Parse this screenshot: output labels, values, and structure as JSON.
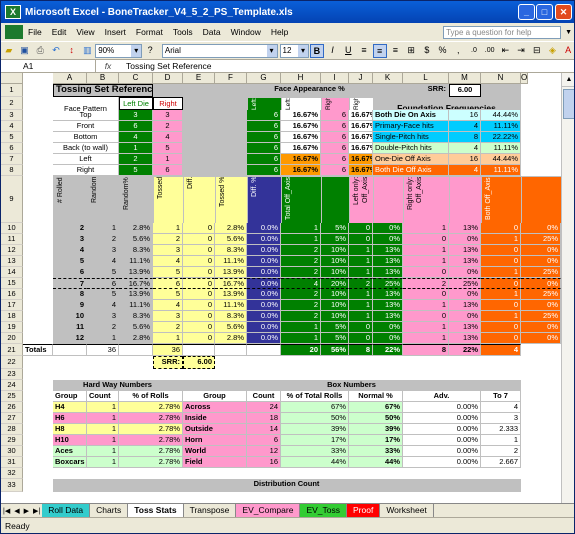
{
  "window": {
    "title": "Microsoft Excel - BoneTracker_V4_5_2_PS_Template.xls"
  },
  "menu": [
    "File",
    "Edit",
    "View",
    "Insert",
    "Format",
    "Tools",
    "Data",
    "Window",
    "Help"
  ],
  "help_placeholder": "Type a question for help",
  "toolbar": {
    "zoom": "90%",
    "font": "Arial",
    "size": "12"
  },
  "formula": {
    "cell": "A1",
    "fx": "fx",
    "content": "Tossing Set Reference"
  },
  "columns": [
    "A",
    "B",
    "C",
    "D",
    "E",
    "F",
    "G",
    "H",
    "I",
    "J",
    "K",
    "L",
    "M",
    "N",
    "O"
  ],
  "rows": [
    "1",
    "2",
    "3",
    "4",
    "5",
    "6",
    "7",
    "8",
    "9",
    "10",
    "11",
    "12",
    "13",
    "14",
    "15",
    "16",
    "17",
    "18",
    "19",
    "20",
    "21",
    "22",
    "23",
    "24",
    "25",
    "26",
    "27",
    "28",
    "29",
    "30",
    "31",
    "32",
    "33"
  ],
  "top": {
    "title": "Tossing Set Reference",
    "face_pattern": "Face Pattern",
    "left_die": "Left Die",
    "right_die": "Right Die",
    "face_appearance": "Face Appearance %",
    "srr_label": "SRR:",
    "srr_value": "6.00",
    "foundation": "Foundation Frequencies",
    "left_count": "Left: Count",
    "left_pct": "Left: %",
    "right_count": "Right: Count",
    "right_pct": "Right: %"
  },
  "faces": [
    {
      "name": "Top",
      "l": "3",
      "r": "3",
      "lc": "6",
      "lp": "16.67%",
      "rc": "6",
      "rp": "16.67%",
      "f": "Both Die On Axis",
      "fn": "16",
      "fp": "44.44%"
    },
    {
      "name": "Front",
      "l": "6",
      "r": "2",
      "lc": "6",
      "lp": "16.67%",
      "rc": "6",
      "rp": "16.67%",
      "f": "Primary-Face hits",
      "fn": "4",
      "fp": "11.11%"
    },
    {
      "name": "Bottom",
      "l": "4",
      "r": "4",
      "lc": "6",
      "lp": "16.67%",
      "rc": "6",
      "rp": "16.67%",
      "f": "Single-Pitch hits",
      "fn": "8",
      "fp": "22.22%"
    },
    {
      "name": "Back (to wall)",
      "l": "1",
      "r": "5",
      "lc": "6",
      "lp": "16.67%",
      "rc": "6",
      "rp": "16.67%",
      "f": "Double-Pitch hits",
      "fn": "4",
      "fp": "11.11%"
    },
    {
      "name": "Left",
      "l": "2",
      "r": "1",
      "lc": "6",
      "lp": "16.67%",
      "rc": "6",
      "rp": "16.67%",
      "f": "One-Die Off Axis",
      "fn": "16",
      "fp": "44.44%"
    },
    {
      "name": "Right",
      "l": "5",
      "r": "6",
      "lc": "6",
      "lp": "16.67%",
      "rc": "6",
      "rp": "16.67%",
      "f": "Both Die Off Axis",
      "fn": "4",
      "fp": "11.11%"
    }
  ],
  "hdr9": [
    "# Rolled",
    "Random",
    "Random%",
    "Tossed",
    "Diff.",
    "Tossed %",
    "Diff. %",
    "Total Off_Axis",
    "",
    "Left only: Off_Axis",
    "",
    "Right only: Off_Axis",
    "",
    "Both Off_Axis",
    ""
  ],
  "rolls": [
    [
      "2",
      "1",
      "2.8%",
      "1",
      "0",
      "2.8%",
      "0.0%",
      "1",
      "5%",
      "0",
      "0%",
      "1",
      "13%",
      "0",
      "0%"
    ],
    [
      "3",
      "2",
      "5.6%",
      "2",
      "0",
      "5.6%",
      "0.0%",
      "1",
      "5%",
      "0",
      "0%",
      "0",
      "0%",
      "1",
      "25%"
    ],
    [
      "4",
      "3",
      "8.3%",
      "3",
      "0",
      "8.3%",
      "0.0%",
      "2",
      "10%",
      "1",
      "13%",
      "1",
      "13%",
      "0",
      "0%"
    ],
    [
      "5",
      "4",
      "11.1%",
      "4",
      "0",
      "11.1%",
      "0.0%",
      "2",
      "10%",
      "1",
      "13%",
      "1",
      "13%",
      "0",
      "0%"
    ],
    [
      "6",
      "5",
      "13.9%",
      "5",
      "0",
      "13.9%",
      "0.0%",
      "2",
      "10%",
      "1",
      "13%",
      "0",
      "0%",
      "1",
      "25%"
    ],
    [
      "7",
      "6",
      "16.7%",
      "6",
      "0",
      "16.7%",
      "0.0%",
      "4",
      "20%",
      "2",
      "25%",
      "2",
      "25%",
      "0",
      "0%"
    ],
    [
      "8",
      "5",
      "13.9%",
      "5",
      "0",
      "13.9%",
      "0.0%",
      "2",
      "10%",
      "1",
      "13%",
      "0",
      "0%",
      "1",
      "25%"
    ],
    [
      "9",
      "4",
      "11.1%",
      "4",
      "0",
      "11.1%",
      "0.0%",
      "2",
      "10%",
      "1",
      "13%",
      "1",
      "13%",
      "0",
      "0%"
    ],
    [
      "10",
      "3",
      "8.3%",
      "3",
      "0",
      "8.3%",
      "0.0%",
      "2",
      "10%",
      "1",
      "13%",
      "0",
      "0%",
      "1",
      "25%"
    ],
    [
      "11",
      "2",
      "5.6%",
      "2",
      "0",
      "5.6%",
      "0.0%",
      "1",
      "5%",
      "0",
      "0%",
      "1",
      "13%",
      "0",
      "0%"
    ],
    [
      "12",
      "1",
      "2.8%",
      "1",
      "0",
      "2.8%",
      "0.0%",
      "1",
      "5%",
      "0",
      "0%",
      "1",
      "13%",
      "0",
      "0%"
    ]
  ],
  "totals": {
    "label": "Totals",
    "random": "36",
    "tossed": "36",
    "t1": "20",
    "t2": "56%",
    "l1": "8",
    "l2": "22%",
    "r1": "8",
    "r2": "22%",
    "b1": "4",
    "b2": "11%"
  },
  "srr2": {
    "label": "SRR:",
    "value": "6.00"
  },
  "hardway": {
    "title": "Hard Way Numbers",
    "h": [
      "Group",
      "Count",
      "% of Rolls"
    ],
    "rows": [
      [
        "H4",
        "1",
        "2.78%"
      ],
      [
        "H6",
        "1",
        "2.78%"
      ],
      [
        "H8",
        "1",
        "2.78%"
      ],
      [
        "H10",
        "1",
        "2.78%"
      ],
      [
        "Aces",
        "1",
        "2.78%"
      ],
      [
        "Boxcars",
        "1",
        "2.78%"
      ]
    ]
  },
  "box": {
    "title": "Box Numbers",
    "h": [
      "Group",
      "Count",
      "% of Total Rolls",
      "Normal %",
      "Adv.",
      "To 7"
    ],
    "rows": [
      [
        "Across",
        "24",
        "67%",
        "67%",
        "0.00%",
        "4"
      ],
      [
        "Inside",
        "18",
        "50%",
        "50%",
        "0.00%",
        "3"
      ],
      [
        "Outside",
        "14",
        "39%",
        "39%",
        "0.00%",
        "2.333"
      ],
      [
        "Horn",
        "6",
        "17%",
        "17%",
        "0.00%",
        "1"
      ],
      [
        "World",
        "12",
        "33%",
        "33%",
        "0.00%",
        "2"
      ],
      [
        "Field",
        "16",
        "44%",
        "44%",
        "0.00%",
        "2.667"
      ]
    ]
  },
  "distribution": "Distribution Count",
  "tabs": [
    "Roll Data",
    "Charts",
    "Toss Stats",
    "Transpose",
    "EV_Compare",
    "EV_Toss",
    "Proof",
    "Worksheet"
  ],
  "status": "Ready",
  "colors": {
    "green": "#008000",
    "pink": "#ff99cc",
    "yellow": "#ffff99",
    "orange": "#ff6600",
    "blue": "#333399",
    "cyan": "#00ccff",
    "lime": "#ccffcc",
    "grey": "#c0c0c0"
  }
}
